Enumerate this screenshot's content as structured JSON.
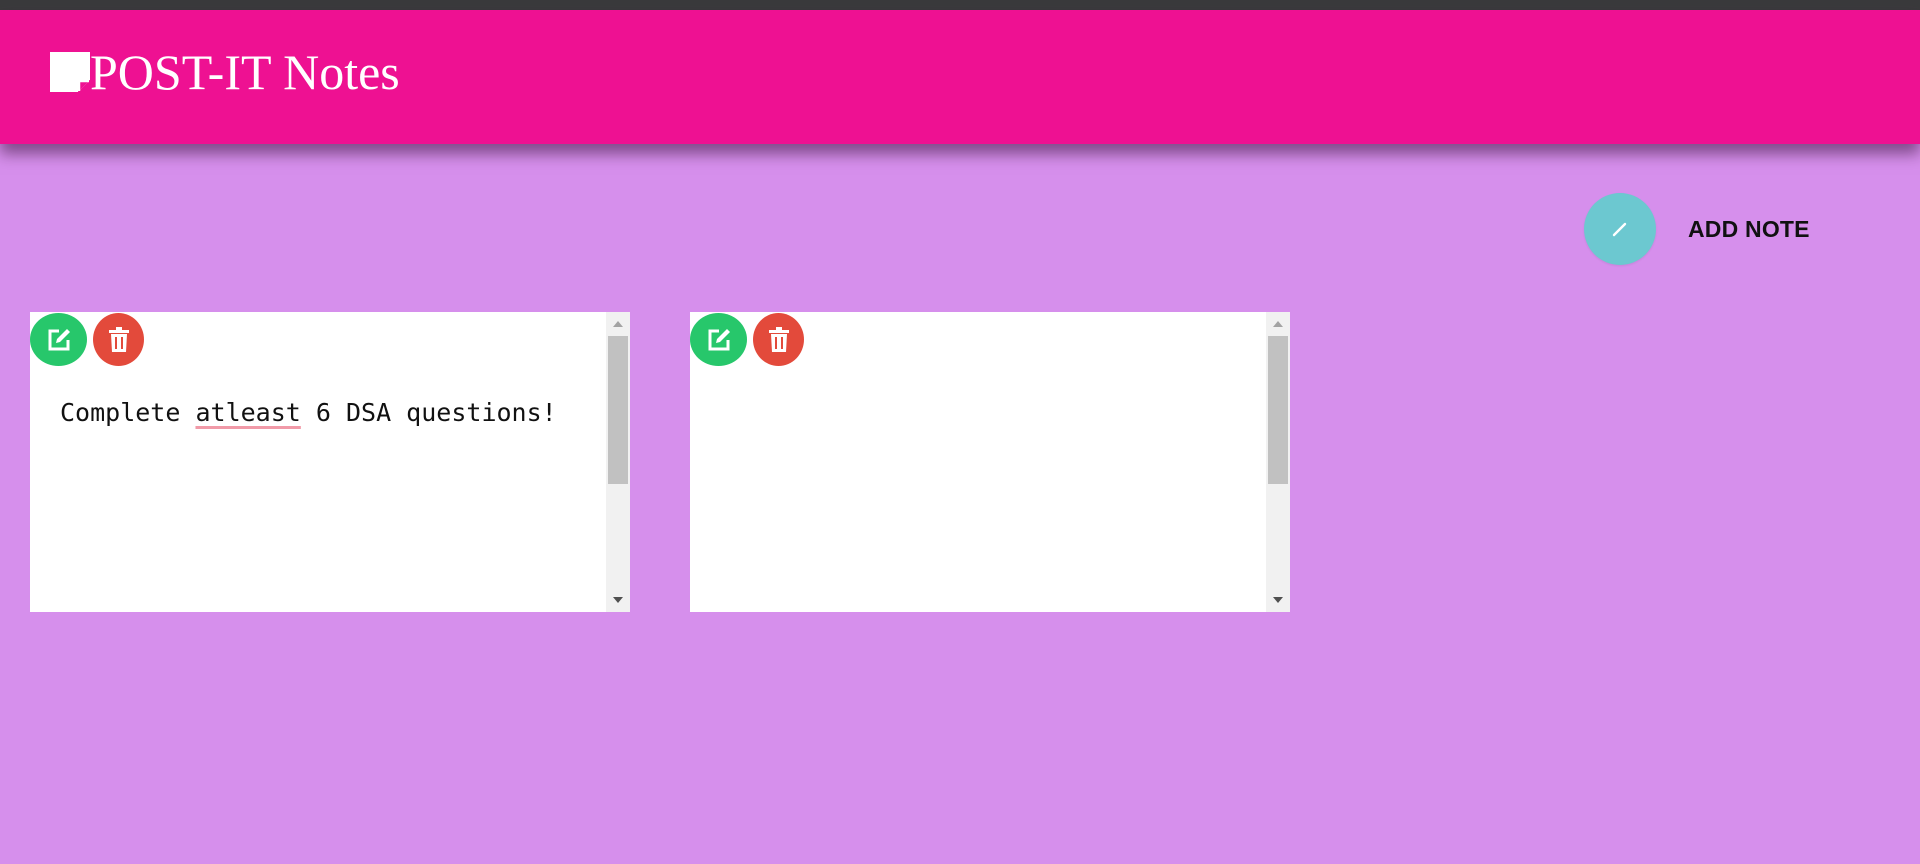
{
  "header": {
    "title": "POST-IT Notes",
    "logo_icon": "sticky-note-icon",
    "background": "#ee1192"
  },
  "toolbar": {
    "add_icon": "pencil-icon",
    "add_label": "ADD NOTE",
    "add_button_color": "#6cc8d0"
  },
  "notes": [
    {
      "text_before": "Complete ",
      "text_misspelled": "atleast",
      "text_after": " 6 DSA questions!",
      "edit_icon": "edit-icon",
      "delete_icon": "trash-icon"
    },
    {
      "text_before": "",
      "text_misspelled": "",
      "text_after": "",
      "edit_icon": "edit-icon",
      "delete_icon": "trash-icon"
    }
  ],
  "colors": {
    "page_background": "#d68fec",
    "edit_button": "#27c76b",
    "delete_button": "#e34a3b"
  }
}
